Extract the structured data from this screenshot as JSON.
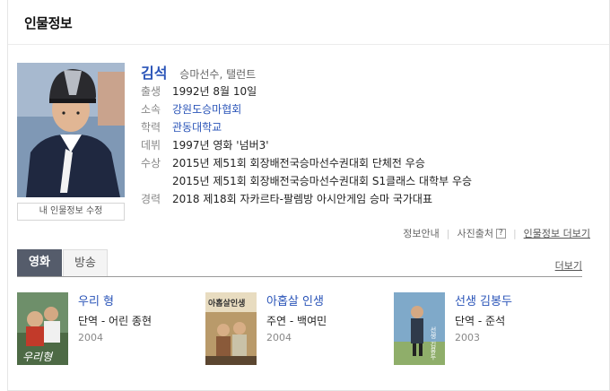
{
  "header": {
    "title": "인물정보"
  },
  "person": {
    "name": "김석",
    "job": "승마선수, 탤런트",
    "fields": {
      "born_key": "출생",
      "born": "1992년 8월 10일",
      "org_key": "소속",
      "org": "강원도승마협회",
      "school_key": "학력",
      "school": "관동대학교",
      "debut_key": "데뷔",
      "debut": "1997년 영화 '넘버3'",
      "award_key": "수상",
      "awards": [
        "2015년 제51회 회장배전국승마선수권대회 단체전 우승",
        "2015년 제51회 회장배전국승마선수권대회 S1클래스 대학부 우승"
      ],
      "career_key": "경력",
      "career": "2018 제18회 자카르타-팔렘방 아시안게임 승마 국가대표"
    },
    "edit_label": "내 인물정보 수정"
  },
  "source_row": {
    "info_guide": "정보안내",
    "photo_source": "사진출처",
    "help_icon": "?",
    "more_label": "인물정보 더보기"
  },
  "tabs": {
    "active": "영화",
    "inactive": "방송",
    "more": "더보기"
  },
  "movies": [
    {
      "title": "우리 형",
      "role": "단역 - 어린 종현",
      "year": "2004",
      "poster_text": "우리형"
    },
    {
      "title": "아홉살 인생",
      "role": "주연 - 백여민",
      "year": "2004",
      "poster_text": "아홉살인생"
    },
    {
      "title": "선생 김봉두",
      "role": "단역 - 준석",
      "year": "2003",
      "poster_text": "선생 김봉두"
    }
  ],
  "colors": {
    "link": "#2a54b8",
    "tab_active": "#555c6b"
  }
}
